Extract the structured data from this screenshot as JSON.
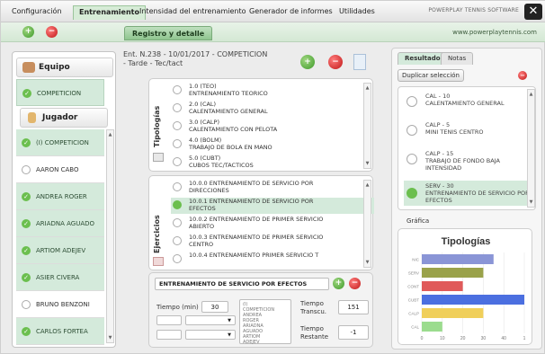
{
  "menu": {
    "tabs": [
      "Configuración",
      "Entrenamiento",
      "Intensidad del entrenamiento",
      "Generador de informes",
      "Utilidades"
    ],
    "brand": "POWERPLAY TENNIS SOFTWARE",
    "close": "✕"
  },
  "toolbar": {
    "subtab": "Registro y detalle",
    "site": "www.powerplaytennis.com"
  },
  "left": {
    "equipo_header": "Equipo",
    "equipo_items": [
      {
        "label": "COMPETICION",
        "checked": true
      }
    ],
    "jugador_header": "Jugador",
    "jugador_items": [
      {
        "label": "(I) COMPETICION",
        "checked": true
      },
      {
        "label": "AARON CABO",
        "checked": false
      },
      {
        "label": "ANDREA ROGER",
        "checked": true
      },
      {
        "label": "ARIADNA AGUADO",
        "checked": true
      },
      {
        "label": "ARTIOM ADEJEV",
        "checked": true
      },
      {
        "label": "ASIER CIVERA",
        "checked": true
      },
      {
        "label": "BRUNO BENZONI",
        "checked": false
      },
      {
        "label": "CARLOS FORTEA",
        "checked": true
      }
    ]
  },
  "session": {
    "title_line1": "Ent. N.238 - 10/01/2017 - COMPETICION",
    "title_line2": "- Tarde - Tec/tact"
  },
  "tipologias": {
    "label": "Tipologías",
    "items": [
      {
        "code": "1.0 (TEO)",
        "name": "ENTRENAMIENTO TEORICO"
      },
      {
        "code": "2.0 (CAL)",
        "name": "CALENTAMIENTO GENERAL"
      },
      {
        "code": "3.0 (CALP)",
        "name": "CALENTAMIENTO CON PELOTA"
      },
      {
        "code": "4.0 (BOLM)",
        "name": "TRABAJO DE BOLA EN MANO"
      },
      {
        "code": "5.0 (CUBT)",
        "name": "CUBOS TEC/TACTICOS"
      }
    ]
  },
  "ejercicios": {
    "label": "Ejercicios",
    "items": [
      {
        "code": "10.0.0 ENTRENAMIENTO DE SERVICIO POR",
        "name": "DIRECCIONES",
        "selected": false
      },
      {
        "code": "10.0.1 ENTRENAMIENTO DE SERVICIO POR",
        "name": "EFECTOS",
        "selected": true
      },
      {
        "code": "10.0.2 ENTRENAMIENTO DE PRIMER SERVICIO",
        "name": "ABIERTO",
        "selected": false
      },
      {
        "code": "10.0.3 ENTRENAMIENTO DE PRIMER SERVICIO",
        "name": "CENTRO",
        "selected": false
      },
      {
        "code": "10.0.4 ENTRENAMIENTO PRIMER SERVICIO T",
        "name": "",
        "selected": false
      }
    ]
  },
  "detail": {
    "exercise_name": "ENTRENAMIENTO DE SERVICIO POR EFECTOS",
    "tiempo_label": "Tiempo (min)",
    "tiempo_value": "30",
    "players_list": [
      "(I)",
      "COMPETICION",
      "ANDREA",
      "ROGER",
      "ARIADNA",
      "AGUADO",
      "ARTIOM",
      "ADEJEV"
    ],
    "tiempo_transcu_label": "Tiempo Transcu.",
    "tiempo_transcu_value": "151",
    "tiempo_restante_label": "Tiempo Restante",
    "tiempo_restante_value": "-1"
  },
  "right": {
    "tabs": [
      "Resultado",
      "Notas"
    ],
    "dup_button": "Duplicar selección",
    "items": [
      {
        "code": "CAL - 10",
        "name": "CALENTAMIENTO GENERAL",
        "selected": false
      },
      {
        "code": "CALP - 5",
        "name": "MINI TENIS CENTRO",
        "selected": false
      },
      {
        "code": "CALP - 15",
        "name": "TRABAJO DE FONDO BAJA INTENSIDAD",
        "selected": false
      },
      {
        "code": "SERV - 30",
        "name": "ENTRENAMIENTO DE SERVICIO POR EFECTOS",
        "selected": true
      }
    ],
    "grafica_label": "Gráfica"
  },
  "chart_data": {
    "type": "bar",
    "orientation": "horizontal",
    "title": "Tipologías",
    "categories": [
      "NIC",
      "SERV",
      "CONT",
      "CUBT",
      "CALP",
      "CAL"
    ],
    "values": [
      35,
      30,
      20,
      50,
      30,
      10
    ],
    "colors": [
      "#8a95d6",
      "#9aa24a",
      "#e05a5a",
      "#4b6fe0",
      "#f0cf5a",
      "#9bdc8e"
    ],
    "xlim": [
      0,
      50
    ],
    "xticks": [
      "0",
      "10",
      "20",
      "30",
      "40",
      "1"
    ]
  }
}
